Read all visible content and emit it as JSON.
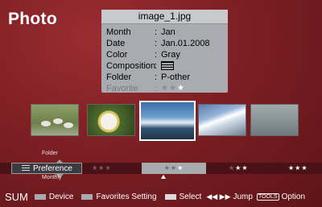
{
  "app": {
    "title": "Photo"
  },
  "info": {
    "filename": "image_1.jpg",
    "rows": [
      {
        "key": "Month",
        "value": "Jan"
      },
      {
        "key": "Date",
        "value": "Jan.01.2008"
      },
      {
        "key": "Color",
        "value": "Gray"
      },
      {
        "key": "Composition",
        "value": ""
      },
      {
        "key": "Folder",
        "value": "P-other"
      }
    ],
    "favorite_label": "Favorite",
    "separator": ":",
    "favorite_rating": "1 of 3 stars"
  },
  "sort": {
    "prev_label": "Folder",
    "current_label": "Preference",
    "next_label": "Monthly"
  },
  "pref_groups": [
    {
      "dim": "★★★",
      "on": ""
    },
    {
      "dim": "★★",
      "on": "★"
    },
    {
      "dim": "★",
      "on": "★★"
    },
    {
      "dim": "",
      "on": "★★★"
    }
  ],
  "bottom": {
    "sum": "SUM",
    "device": "Device",
    "favorites_setting": "Favorites Setting",
    "select": "Select",
    "jump_icon": "◀◀ ▶▶",
    "jump": "Jump",
    "tools": "TOOLS",
    "option": "Option"
  },
  "colors": {
    "background": "#7d1f24",
    "info_panel": "#a9abb0",
    "selection_highlight": "#a9aaad"
  }
}
